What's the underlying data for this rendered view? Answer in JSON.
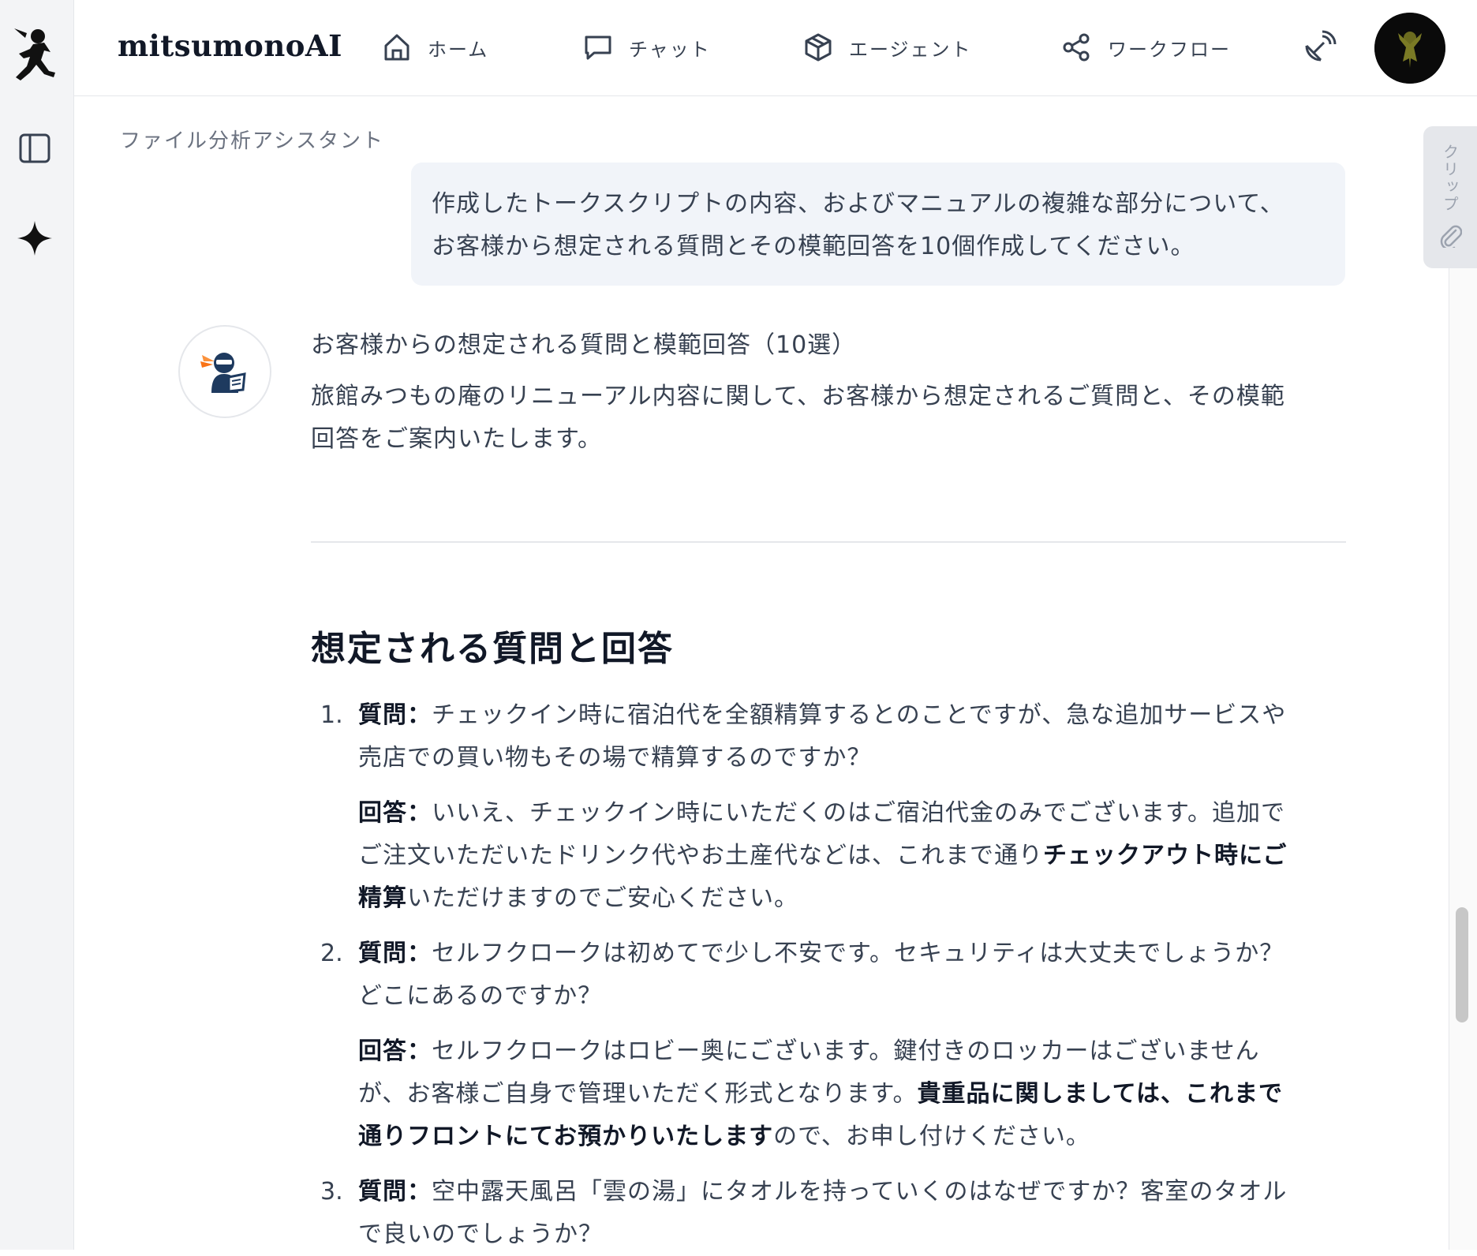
{
  "brand": "mitsumonoAI",
  "nav": {
    "home": "ホーム",
    "chat": "チャット",
    "agent": "エージェント",
    "workflow": "ワークフロー"
  },
  "breadcrumb": "ファイル分析アシスタント",
  "clip_label": "クリップ",
  "user_message": {
    "line1": "作成したトークスクリプトの内容、およびマニュアルの複雑な部分について、",
    "line2": "お客様から想定される質問とその模範回答を10個作成してください。"
  },
  "answer": {
    "title": "お客様からの想定される質問と模範回答（10選）",
    "intro_line1": "旅館みつもの庵のリニューアル内容に関して、お客様から想定されるご質問と、その模範",
    "intro_line2": "回答をご案内いたします。",
    "heading": "想定される質問と回答",
    "q_label": "質問：",
    "a_label": "回答：",
    "items": [
      {
        "num": "1.",
        "q1": "チェックイン時に宿泊代を全額精算するとのことですが、急な追加サービスや",
        "q2": "売店での買い物もその場で精算するのですか？",
        "a1": "いいえ、チェックイン時にいただくのはご宿泊代金のみでございます。追加で",
        "a2_pre": "ご注文いただいたドリンク代やお土産代などは、これまで通り",
        "a2_bold": "チェックアウト時にご",
        "a3_bold": "精算",
        "a3_post": "いただけますのでご安心ください。"
      },
      {
        "num": "2.",
        "q1": "セルフクロークは初めてで少し不安です。セキュリティは大丈夫でしょうか？",
        "q2": "どこにあるのですか？",
        "a1": "セルフクロークはロビー奥にございます。鍵付きのロッカーはございません",
        "a2_pre": "が、お客様ご自身で管理いただく形式となります。",
        "a2_bold": "貴重品に関しましては、これまで",
        "a3_bold": "通りフロントにてお預かりいたします",
        "a3_post": "ので、お申し付けください。"
      },
      {
        "num": "3.",
        "q1": "空中露天風呂「雲の湯」にタオルを持っていくのはなぜですか？客室のタオル",
        "q2": "で良いのでしょうか？"
      }
    ]
  }
}
